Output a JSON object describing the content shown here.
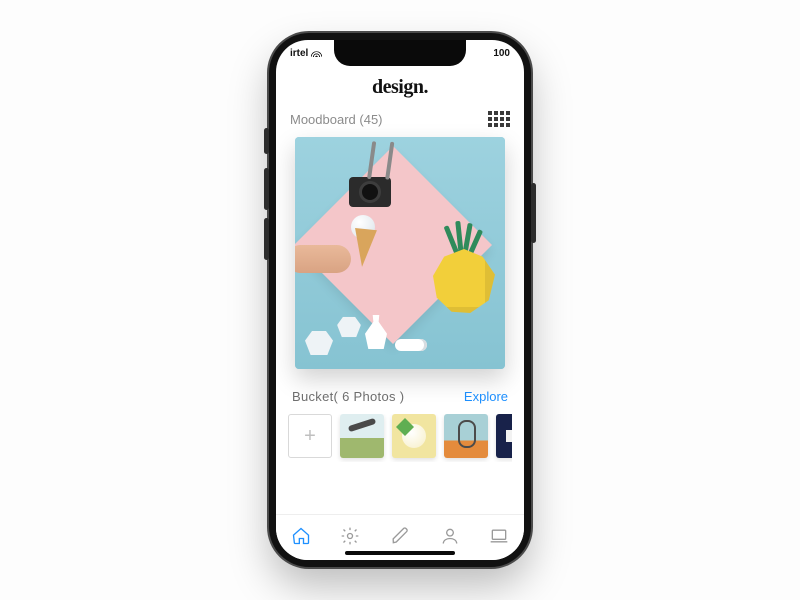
{
  "status": {
    "carrier": "irtel",
    "battery_text": "100"
  },
  "app": {
    "title": "design."
  },
  "moodboard": {
    "title": "Moodboard (45)"
  },
  "bucket": {
    "title": "Bucket( 6 Photos )",
    "explore_label": "Explore",
    "add_label": "+"
  },
  "tabs": {
    "home": "home-icon",
    "settings": "gear-icon",
    "edit": "pencil-icon",
    "profile": "person-icon",
    "inbox": "laptop-icon"
  }
}
